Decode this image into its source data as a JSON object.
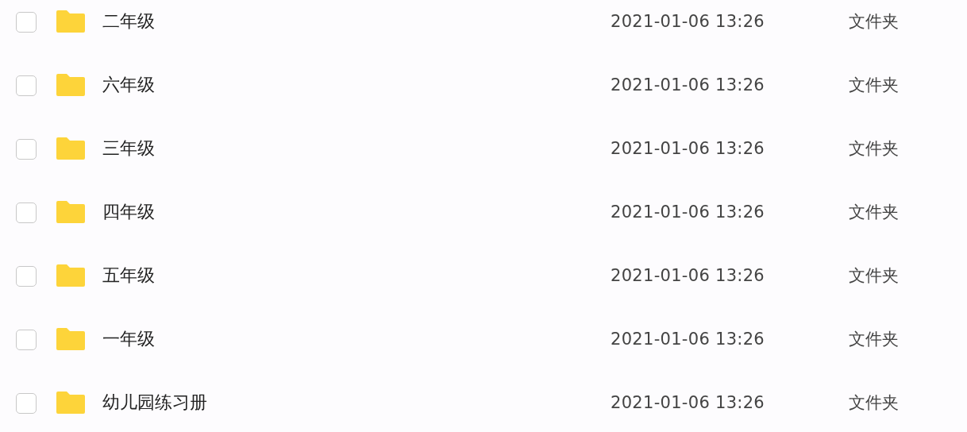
{
  "files": [
    {
      "name": "二年级",
      "modified": "2021-01-06 13:26",
      "type": "文件夹",
      "checked": false
    },
    {
      "name": "六年级",
      "modified": "2021-01-06 13:26",
      "type": "文件夹",
      "checked": false
    },
    {
      "name": "三年级",
      "modified": "2021-01-06 13:26",
      "type": "文件夹",
      "checked": false
    },
    {
      "name": "四年级",
      "modified": "2021-01-06 13:26",
      "type": "文件夹",
      "checked": false
    },
    {
      "name": "五年级",
      "modified": "2021-01-06 13:26",
      "type": "文件夹",
      "checked": false
    },
    {
      "name": "一年级",
      "modified": "2021-01-06 13:26",
      "type": "文件夹",
      "checked": false
    },
    {
      "name": "幼儿园练习册",
      "modified": "2021-01-06 13:26",
      "type": "文件夹",
      "checked": false
    }
  ]
}
